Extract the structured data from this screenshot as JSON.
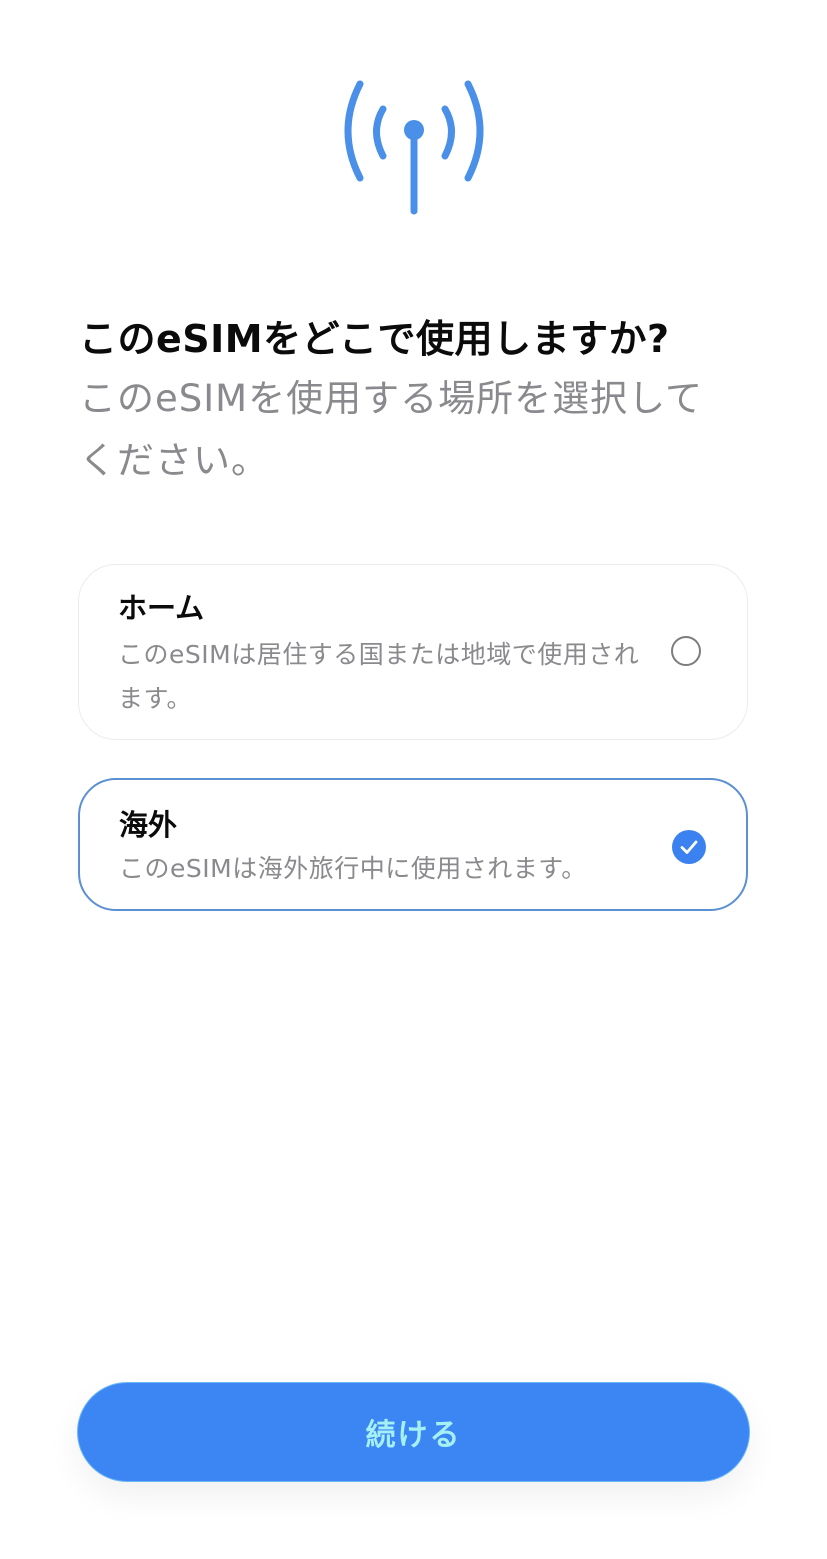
{
  "header": {
    "icon": "antenna-signal-icon",
    "title": "このeSIMをどこで使用しますか?",
    "subtitle": "このeSIMを使用する場所を選択してください。"
  },
  "options": [
    {
      "title": "ホーム",
      "description": "このeSIMは居住する国または地域で使用されます。",
      "selected": false
    },
    {
      "title": "海外",
      "description": "このeSIMは海外旅行中に使用されます。",
      "selected": true
    }
  ],
  "footer": {
    "continue_label": "続ける"
  },
  "colors": {
    "accent": "#3b86f3",
    "antenna": "#4a8fe8",
    "selected_border": "#5b90d2",
    "secondary_text": "#8a8a8e"
  }
}
